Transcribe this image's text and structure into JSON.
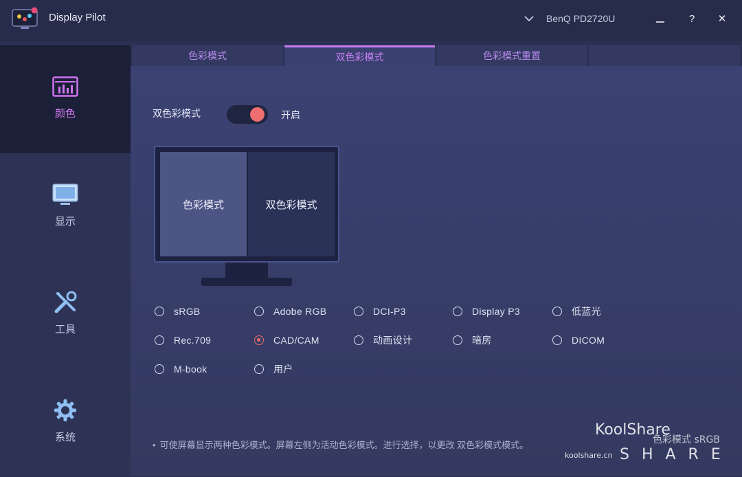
{
  "window": {
    "app_title": "Display Pilot",
    "monitor_name": "BenQ PD2720U",
    "minimize": "—",
    "help": "?",
    "close": "✕"
  },
  "sidebar": {
    "items": [
      {
        "label": "颜色",
        "icon": "color-chart-icon",
        "active": true
      },
      {
        "label": "显示",
        "icon": "display-icon",
        "active": false
      },
      {
        "label": "工具",
        "icon": "tools-icon",
        "active": false
      },
      {
        "label": "系统",
        "icon": "gear-icon",
        "active": false
      }
    ]
  },
  "tabs": [
    {
      "label": "色彩模式",
      "active": false
    },
    {
      "label": "双色彩模式",
      "active": true
    },
    {
      "label": "色彩模式重置",
      "active": false
    }
  ],
  "dual_mode": {
    "label": "双色彩模式",
    "state_label": "开启",
    "enabled": true
  },
  "preview": {
    "left_label": "色彩模式",
    "right_label": "双色彩模式"
  },
  "options": [
    {
      "label": "sRGB",
      "selected": false
    },
    {
      "label": "Adobe RGB",
      "selected": false
    },
    {
      "label": "DCI-P3",
      "selected": false
    },
    {
      "label": "Display P3",
      "selected": false
    },
    {
      "label": "低蓝光",
      "selected": false
    },
    {
      "label": "Rec.709",
      "selected": false
    },
    {
      "label": "CAD/CAM",
      "selected": true
    },
    {
      "label": "动画设计",
      "selected": false
    },
    {
      "label": "暗房",
      "selected": false
    },
    {
      "label": "DICOM",
      "selected": false
    },
    {
      "label": "M-book",
      "selected": false
    },
    {
      "label": "用户",
      "selected": false
    }
  ],
  "note": {
    "bullet": "•",
    "text": "可使屏幕显示两种色彩模式。屏幕左侧为活动色彩模式。进行选择，以更改 双色彩模式模式。"
  },
  "watermark": {
    "brand": "KoolShare",
    "share": "SHARE",
    "site": "koolshare.cn",
    "mode": "色彩模式 sRGB"
  },
  "colors": {
    "accent": "#c77ef2",
    "toggle_knob": "#ee6f6f",
    "selected_radio": "#ec6b6b"
  }
}
